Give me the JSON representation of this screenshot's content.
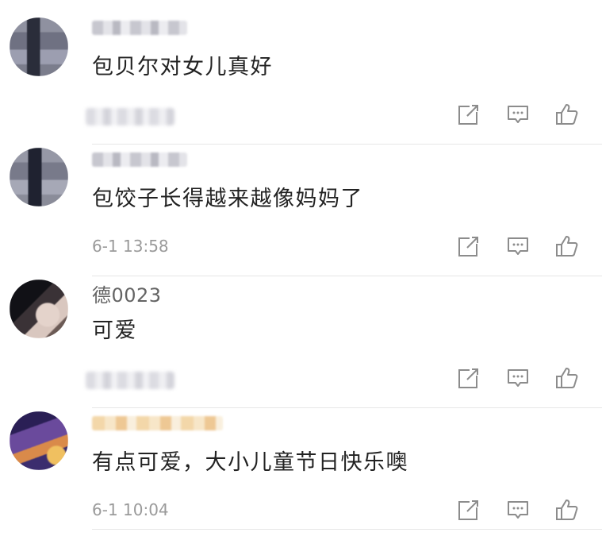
{
  "comments": [
    {
      "username": "",
      "username_blurred": true,
      "text": "包贝尔对女儿真好",
      "time": "",
      "time_blurred": true,
      "avatar_colors": [
        "#7b7d8c",
        "#2a2d3a",
        "#9c9eb0"
      ]
    },
    {
      "username": "",
      "username_blurred": true,
      "text": "包饺子长得越来越像妈妈了",
      "time": "6-1 13:58",
      "time_blurred": false,
      "avatar_colors": [
        "#8a8c99",
        "#1f2230",
        "#a6a8b6"
      ]
    },
    {
      "username": "德0023",
      "username_blurred": false,
      "text": "可爱",
      "time": "",
      "time_blurred": true,
      "avatar_colors": [
        "#1a1a1f",
        "#d9c7bf",
        "#6b5a55"
      ]
    },
    {
      "username": "",
      "username_blurred": true,
      "text": "有点可爱，大小儿童节日快乐噢",
      "time": "6-1 10:04",
      "time_blurred": false,
      "avatar_colors": [
        "#5a3f8c",
        "#d98a4a",
        "#3b2d6e"
      ]
    }
  ],
  "icons": {
    "share": "share-icon",
    "reply": "comment-icon",
    "like": "thumbs-up-icon"
  },
  "colors": {
    "text_primary": "#222222",
    "text_secondary": "#9a9a9a",
    "icon_gray": "#8c8c8c",
    "divider": "#e6e6e6"
  }
}
